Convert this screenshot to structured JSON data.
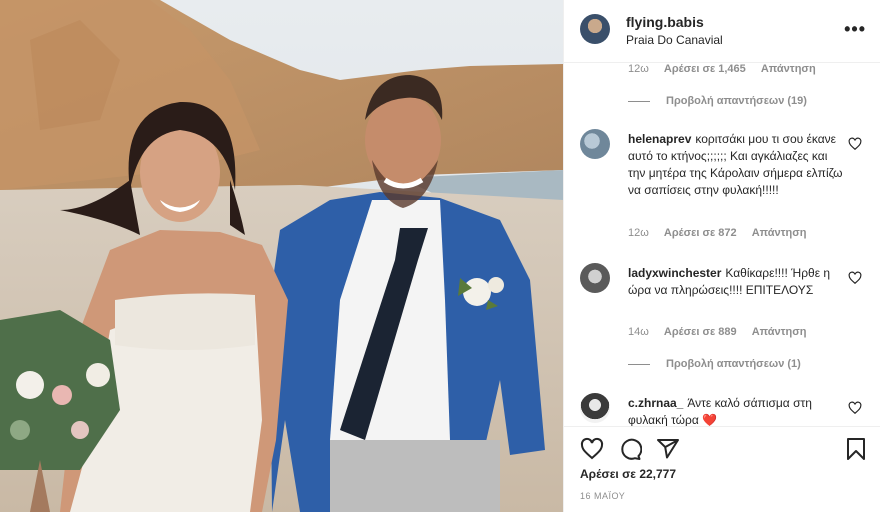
{
  "post": {
    "username": "flying.babis",
    "location": "Praia Do Canavial",
    "more_label": "•••"
  },
  "comments": {
    "prev_meta": {
      "time": "12ω",
      "likes": "Αρέσει σε 1,465",
      "reply": "Απάντηση"
    },
    "prev_view_replies": "Προβολή απαντήσεων (19)",
    "items": [
      {
        "username": "helenaprev",
        "text": "κοριτσάκι μου τι σου έκανε αυτό το κτήνος;;;;;; Και αγκάλιαζες και την μητέρα της Κάρολαιν σήμερα ελπίζω να σαπίσεις στην φυλακή!!!!!",
        "time": "12ω",
        "likes": "Αρέσει σε 872",
        "reply": "Απάντηση",
        "view_replies": ""
      },
      {
        "username": "ladyxwinchester",
        "text": "Καθίκαρε!!!! Ήρθε η ώρα να πληρώσεις!!!! ΕΠΙΤΕΛΟΥΣ",
        "time": "14ω",
        "likes": "Αρέσει σε 889",
        "reply": "Απάντηση",
        "view_replies": "Προβολή απαντήσεων (1)"
      },
      {
        "username": "c.zhrnaa_",
        "text": "Άντε καλό σάπισμα στη φυλακή τώρα ❤️",
        "time": "",
        "likes": "",
        "reply": "",
        "view_replies": ""
      }
    ]
  },
  "footer": {
    "likes": "Αρέσει σε 22,777",
    "date": "16 ΜΑΪΟΥ"
  },
  "colors": {
    "text": "#262626",
    "muted": "#8e8e8e",
    "border": "#efefef",
    "heart": "#ed4956"
  }
}
